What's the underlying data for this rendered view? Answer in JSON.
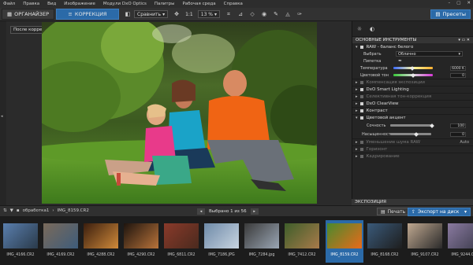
{
  "menu": {
    "items": [
      "Файл",
      "Правка",
      "Вид",
      "Изображение",
      "Модули DxO Optics",
      "Палитры",
      "Рабочая среда",
      "Справка"
    ]
  },
  "toolbar": {
    "organizer": "ОРГАНАЙЗЕР",
    "correction": "КОРРЕКЦИЯ",
    "compare": "Сравнить",
    "ratio": "1:1",
    "zoom": "13 %",
    "presets": "Пресеты"
  },
  "viewer": {
    "badge": "После коррекции"
  },
  "panel": {
    "basic_tools": "ОСНОВНЫЕ ИНСТРУМЕНТЫ",
    "wb_title": "RAW - баланс белого",
    "select_label": "Выбрать",
    "select_value": "Облачно",
    "pipette_label": "Пипетка",
    "temp_label": "Температура",
    "temp_value": "6000 K",
    "tint_label": "Цветовой тон",
    "tint_value": "0",
    "exposure": "Компенсация экспозиции",
    "smart_lighting": "DxO Smart Lighting",
    "selective_tone": "Селективная тон-коррекция",
    "clearview": "DxO ClearView",
    "contrast": "Контраст",
    "color_accent": "Цветовой акцент",
    "vibrancy_label": "Сочность",
    "vibrancy_value": "100",
    "saturation_label": "Насыщенность",
    "saturation_value": "0",
    "noise": "Уменьшение шума RAW",
    "noise_mode": "Auto",
    "horizon": "Горизонт",
    "crop": "Кадрирование",
    "exec_header": "ЭКСПОЗИЦИЯ"
  },
  "filmbar": {
    "project": "обработка1",
    "current_file": "IMG_8159.CR2",
    "selection": "Выбрано 1 из 56",
    "print": "Печать",
    "export": "Экспорт на диск"
  },
  "filmstrip": [
    {
      "name": "IMG_4166.CR2",
      "c1": "#5a7fae",
      "c2": "#2a3a4a"
    },
    {
      "name": "IMG_4169.CR2",
      "c1": "#7a6a5a",
      "c2": "#3e5c7a"
    },
    {
      "name": "IMG_4288.CR2",
      "c1": "#3a1e0e",
      "c2": "#d08a3a"
    },
    {
      "name": "IMG_4290.CR2",
      "c1": "#1e140e",
      "c2": "#b8733a"
    },
    {
      "name": "IMG_6811.CR2",
      "c1": "#8a3a2a",
      "c2": "#4a2a1e"
    },
    {
      "name": "IMG_7186.JPG",
      "c1": "#6e8aa8",
      "c2": "#c8d4e0"
    },
    {
      "name": "IMG_7284.jpg",
      "c1": "#3a3a3a",
      "c2": "#9aa6b4"
    },
    {
      "name": "IMG_7412.CR2",
      "c1": "#3e5e2a",
      "c2": "#a87a4a"
    },
    {
      "name": "IMG_8159.CR2",
      "c1": "#4a8a2e",
      "c2": "#e86a1a"
    },
    {
      "name": "IMG_8168.CR2",
      "c1": "#3a5a7a",
      "c2": "#1e1e1e"
    },
    {
      "name": "IMG_9107.CR2",
      "c1": "#c0a890",
      "c2": "#2a2a2a"
    },
    {
      "name": "IMG_9244.CR2",
      "c1": "#8a7aa0",
      "c2": "#3a3a4a"
    }
  ]
}
